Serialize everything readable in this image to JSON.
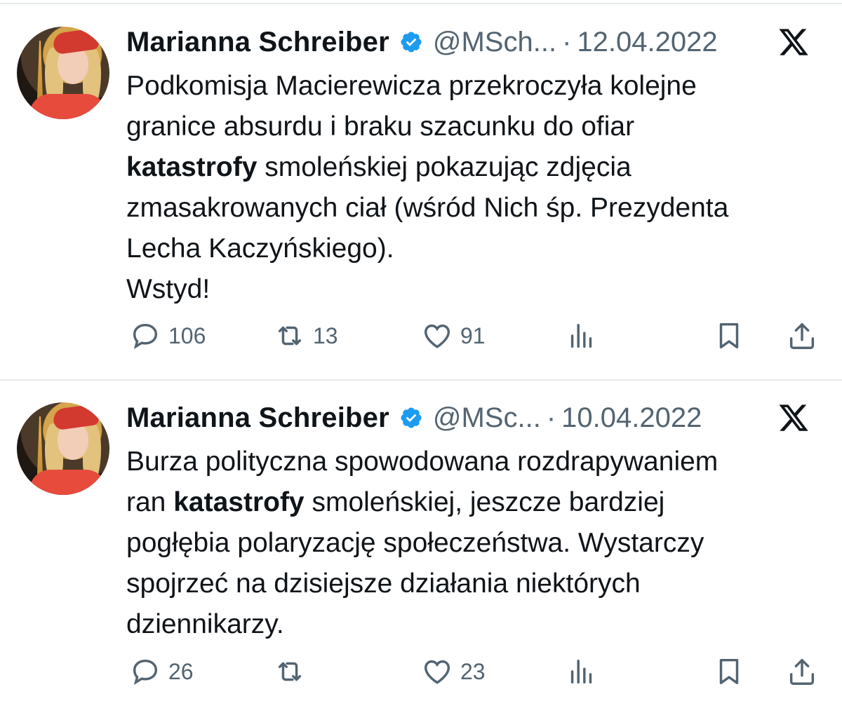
{
  "tweets": [
    {
      "author_name": "Marianna Schreiber",
      "handle": "@MSch...",
      "separator": "·",
      "date": "12.04.2022",
      "lines": [
        [
          {
            "t": "Podkomisja Macierewicza przekroczyła kolejne",
            "b": false
          }
        ],
        [
          {
            "t": "granice absurdu i braku szacunku do ofiar",
            "b": false
          }
        ],
        [
          {
            "t": "katastrofy",
            "b": true
          },
          {
            "t": " smoleńskiej pokazując zdjęcia",
            "b": false
          }
        ],
        [
          {
            "t": "zmasakrowanych ciał (wśród Nich śp. Prezydenta",
            "b": false
          }
        ],
        [
          {
            "t": "Lecha Kaczyńskiego).",
            "b": false
          }
        ],
        [
          {
            "t": "Wstyd!",
            "b": false
          }
        ]
      ],
      "reply_count": "106",
      "retweet_count": "13",
      "like_count": "91"
    },
    {
      "author_name": "Marianna Schreiber",
      "handle": "@MSc...",
      "separator": "·",
      "date": "10.04.2022",
      "lines": [
        [
          {
            "t": "Burza polityczna spowodowana rozdrapywaniem",
            "b": false
          }
        ],
        [
          {
            "t": "ran ",
            "b": false
          },
          {
            "t": "katastrofy",
            "b": true
          },
          {
            "t": " smoleńskiej, jeszcze bardziej",
            "b": false
          }
        ],
        [
          {
            "t": "pogłębia polaryzację społeczeństwa. Wystarczy",
            "b": false
          }
        ],
        [
          {
            "t": "spojrzeć na dzisiejsze działania niektórych",
            "b": false
          }
        ],
        [
          {
            "t": "dziennikarzy.",
            "b": false
          }
        ]
      ],
      "reply_count": "26",
      "retweet_count": "",
      "like_count": "23"
    }
  ],
  "icons": {
    "verified": "verified-badge-icon",
    "x_logo": "x-logo-icon",
    "reply": "reply-bubble-icon",
    "retweet": "retweet-icon",
    "like": "heart-icon",
    "views": "views-chart-icon",
    "bookmark": "bookmark-icon",
    "share": "share-icon"
  },
  "colors": {
    "text": "#0f1419",
    "secondary": "#536471",
    "verified": "#1d9bf0",
    "divider": "#e6e9ec"
  }
}
